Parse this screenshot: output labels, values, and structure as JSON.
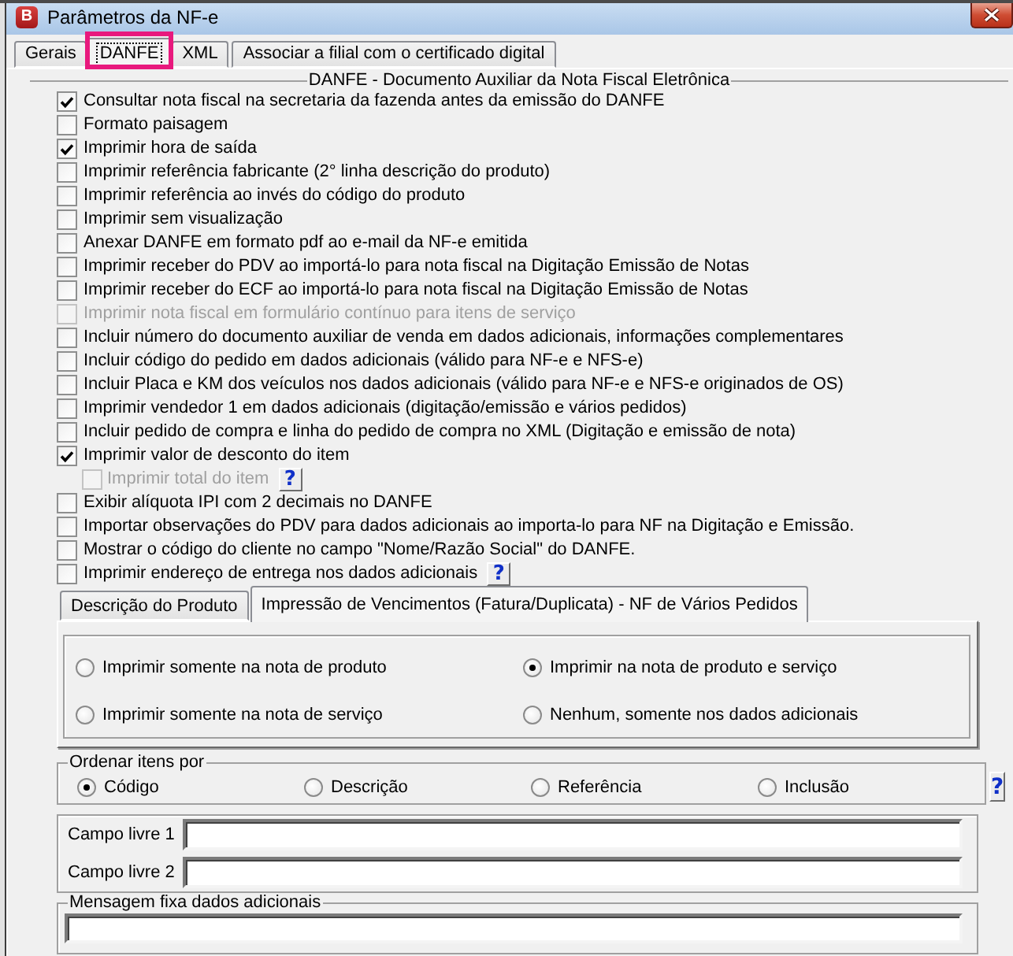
{
  "window": {
    "title": "Parâmetros da NF-e",
    "icon_letter": "B"
  },
  "tabs": [
    {
      "label": "Gerais",
      "selected": false,
      "focused": false,
      "highlighted": false
    },
    {
      "label": "DANFE",
      "selected": true,
      "focused": true,
      "highlighted": true
    },
    {
      "label": "XML",
      "selected": false,
      "focused": false,
      "highlighted": false
    },
    {
      "label": "Associar a filial com o certificado digital",
      "selected": false,
      "focused": false,
      "highlighted": false
    }
  ],
  "danfe_group": {
    "title": "DANFE - Documento Auxiliar da Nota Fiscal Eletrônica",
    "options": [
      {
        "label": "Consultar nota fiscal na secretaria da fazenda antes da emissão do DANFE",
        "checked": true,
        "disabled": false
      },
      {
        "label": "Formato paisagem",
        "checked": false,
        "disabled": false
      },
      {
        "label": "Imprimir hora de saída",
        "checked": true,
        "disabled": false
      },
      {
        "label": "Imprimir referência fabricante (2° linha descrição do produto)",
        "checked": false,
        "disabled": false
      },
      {
        "label": "Imprimir referência ao invés do código do produto",
        "checked": false,
        "disabled": false
      },
      {
        "label": "Imprimir sem visualização",
        "checked": false,
        "disabled": false
      },
      {
        "label": "Anexar DANFE em formato pdf ao e-mail da NF-e emitida",
        "checked": false,
        "disabled": false
      },
      {
        "label": "Imprimir receber do PDV ao importá-lo para nota fiscal na Digitação Emissão de Notas",
        "checked": false,
        "disabled": false
      },
      {
        "label": "Imprimir receber do ECF ao importá-lo para nota fiscal na Digitação Emissão de Notas",
        "checked": false,
        "disabled": false
      },
      {
        "label": "Imprimir nota fiscal em formulário contínuo para itens de serviço",
        "checked": false,
        "disabled": true
      },
      {
        "label": "Incluir número do documento auxiliar de venda em dados adicionais, informações complementares",
        "checked": false,
        "disabled": false
      },
      {
        "label": "Incluir código do pedido em dados adicionais (válido para NF-e e NFS-e)",
        "checked": false,
        "disabled": false
      },
      {
        "label": "Incluir Placa e KM dos veículos nos dados adicionais (válido para NF-e e NFS-e originados de OS)",
        "checked": false,
        "disabled": false
      },
      {
        "label": "Imprimir vendedor 1 em dados adicionais (digitação/emissão e vários pedidos)",
        "checked": false,
        "disabled": false
      },
      {
        "label": "Incluir pedido de compra e linha do pedido de compra no XML (Digitação e emissão de nota)",
        "checked": false,
        "disabled": false
      },
      {
        "label": "Imprimir valor de desconto do item",
        "checked": true,
        "disabled": false,
        "children": [
          {
            "label": "Imprimir total do item",
            "checked": false,
            "disabled": true,
            "help_label": "?"
          }
        ]
      },
      {
        "label": "Exibir alíquota IPI com 2 decimais no DANFE",
        "checked": false,
        "disabled": false
      },
      {
        "label": "Importar observações do PDV para dados adicionais ao importa-lo para NF na Digitação e Emissão.",
        "checked": false,
        "disabled": false
      },
      {
        "label": "Mostrar o código do cliente no campo \"Nome/Razão Social\" do DANFE.",
        "checked": false,
        "disabled": false
      },
      {
        "label": "Imprimir endereço de entrega nos dados adicionais",
        "checked": false,
        "disabled": false,
        "help_label": "?"
      }
    ]
  },
  "sub_tabs": [
    {
      "label": "Descrição do Produto",
      "selected": false
    },
    {
      "label": "Impressão de Vencimentos (Fatura/Duplicata) - NF de Vários Pedidos",
      "selected": true
    }
  ],
  "billing_print_options": [
    {
      "label": "Imprimir somente na nota de produto",
      "selected": false
    },
    {
      "label": "Imprimir na nota de produto e serviço",
      "selected": true
    },
    {
      "label": "Imprimir somente na nota de serviço",
      "selected": false
    },
    {
      "label": "Nenhum, somente nos dados adicionais",
      "selected": false
    }
  ],
  "sort_items": {
    "title": "Ordenar itens por",
    "options": [
      {
        "label": "Código",
        "selected": true
      },
      {
        "label": "Descrição",
        "selected": false
      },
      {
        "label": "Referência",
        "selected": false
      },
      {
        "label": "Inclusão",
        "selected": false
      }
    ],
    "help_label": "?"
  },
  "free_fields": [
    {
      "label": "Campo livre 1"
    },
    {
      "label": "Campo livre 2"
    }
  ],
  "fixed_message": {
    "title": "Mensagem fixa dados adicionais"
  }
}
